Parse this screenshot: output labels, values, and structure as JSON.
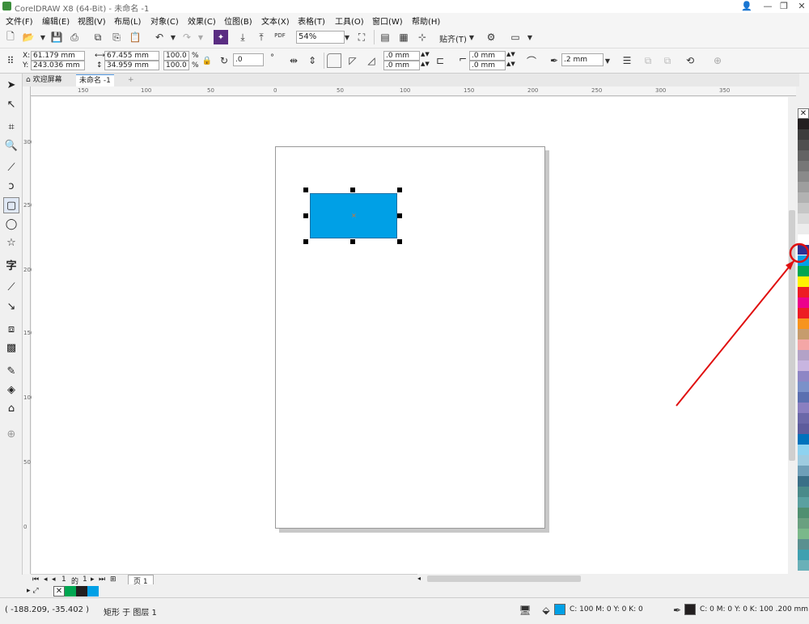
{
  "window": {
    "title": "CorelDRAW X8 (64-Bit) - 未命名 -1",
    "min": "—",
    "restore": "❐",
    "close": "✕"
  },
  "menu": [
    "文件(F)",
    "编辑(E)",
    "视图(V)",
    "布局(L)",
    "对象(C)",
    "效果(C)",
    "位图(B)",
    "文本(X)",
    "表格(T)",
    "工具(O)",
    "窗口(W)",
    "帮助(H)"
  ],
  "standard_toolbar": {
    "pdf_label": "PDF",
    "zoom": "54%",
    "snap_label": "贴齐(T)"
  },
  "property_bar": {
    "x_label": "X:",
    "x": "61.179 mm",
    "y_label": "Y:",
    "y": "243.036 mm",
    "width": "67.455 mm",
    "height": "34.959 mm",
    "scale_w": "100.0",
    "scale_h": "100.0",
    "pct": "%",
    "angle": ".0",
    "degree_symbol": "°",
    "corner1": ".0 mm",
    "corner2": ".0 mm",
    "corner3": ".0 mm",
    "corner4": ".0 mm",
    "outline": ".2 mm"
  },
  "doc_tabs": {
    "welcome": "欢迎屏幕",
    "doc": "未命名 -1",
    "add": "+"
  },
  "hruler_labels": [
    "150",
    "100",
    "50",
    "0",
    "50",
    "100",
    "150",
    "200",
    "250",
    "300",
    "350"
  ],
  "vruler_labels": [
    "300",
    "250",
    "200",
    "150",
    "100",
    "50",
    "0"
  ],
  "page_nav": {
    "current": "1",
    "of": "的",
    "total": "1",
    "page_tab": "页 1"
  },
  "status": {
    "coords": "( -188.209, -35.402 )",
    "object_info": "矩形 于 图层 1",
    "fill_text": "C: 100 M: 0 Y: 0 K: 0",
    "outline_text": "C: 0 M: 0 Y: 0 K: 100  .200 mm"
  },
  "colors": {
    "selected_fill": "#00a0e6",
    "annotation": "#e01010"
  },
  "palette": [
    "none",
    "#231f20",
    "#3d3d3d",
    "#4f4f4f",
    "#636363",
    "#777777",
    "#8a8a8a",
    "#9e9e9e",
    "#b2b2b2",
    "#c6c6c6",
    "#dadada",
    "#ececec",
    "#ffffff",
    "#2e3192",
    "#00a0e6",
    "#00a651",
    "#fff200",
    "#ed1c24",
    "#ec008c",
    "#ed1c24",
    "#f7941d",
    "#c69c6d",
    "#f4a6a6",
    "#b3a2c7",
    "#c8b5e0",
    "#8e86c5",
    "#7b91c9",
    "#5b6fb0",
    "#8a7fc0",
    "#6b68a8",
    "#5d5c9c",
    "#0072bc",
    "#8ed2f0",
    "#9ecbe0",
    "#6f9fb8",
    "#3a6f87",
    "#4a8a8a",
    "#5aa0a0",
    "#4f8f70",
    "#6aa080",
    "#7ab88a",
    "#5a9090",
    "#3fa0b0",
    "#6ab0b8"
  ]
}
